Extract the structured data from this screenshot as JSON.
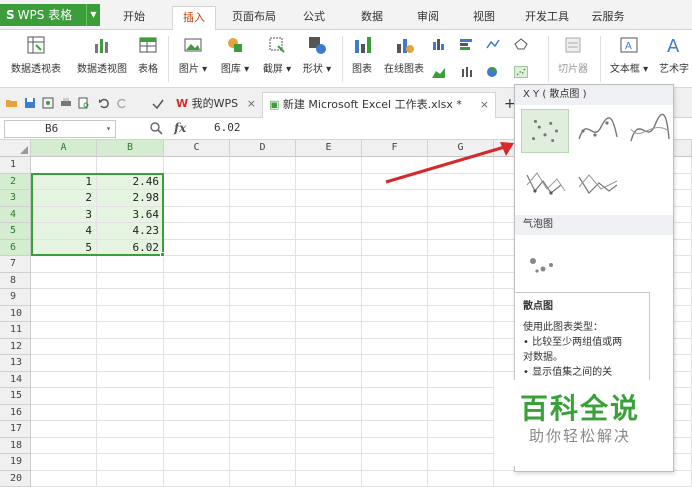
{
  "app": {
    "name": "WPS 表格",
    "logo": "S"
  },
  "ribbon_tabs": [
    {
      "label": "开始"
    },
    {
      "label": "插入"
    },
    {
      "label": "页面布局"
    },
    {
      "label": "公式"
    },
    {
      "label": "数据"
    },
    {
      "label": "审阅"
    },
    {
      "label": "视图"
    },
    {
      "label": "开发工具"
    },
    {
      "label": "云服务"
    }
  ],
  "active_tab": "插入",
  "toolbar": {
    "pivot_table": "数据透视表",
    "pivot_chart": "数据透视图",
    "table": "表格",
    "picture": "图片",
    "gallery": "图库",
    "screenshot": "截屏",
    "shape": "形状",
    "chart": "图表",
    "online_chart": "在线图表",
    "slicer": "切片器",
    "textbox": "文本框",
    "art": "艺术字"
  },
  "doc_tabs": {
    "mywps": "我的WPS",
    "workbook": "新建 Microsoft Excel 工作表.xlsx *",
    "close": "×",
    "add": "+"
  },
  "formula_bar": {
    "cell_ref": "B6",
    "fx": "fx",
    "value": "6.02"
  },
  "columns": [
    "A",
    "B",
    "C",
    "D",
    "E",
    "F",
    "G"
  ],
  "rows": [
    "1",
    "2",
    "3",
    "4",
    "5",
    "6",
    "7",
    "8",
    "9",
    "10",
    "11",
    "12",
    "13",
    "14",
    "15",
    "16",
    "17",
    "18",
    "19",
    "20"
  ],
  "cells": [
    {
      "a": "1",
      "b": "2.46"
    },
    {
      "a": "2",
      "b": "2.98"
    },
    {
      "a": "3",
      "b": "3.64"
    },
    {
      "a": "4",
      "b": "4.23"
    },
    {
      "a": "5",
      "b": "6.02"
    }
  ],
  "chart_panel": {
    "xy_header": "X Y ( 散点图 )",
    "bubble_header": "气泡图"
  },
  "tooltip": {
    "title": "散点图",
    "line1": "使用此图表类型：",
    "line2": "• 比较至少两组值或两",
    "line3": "对数据。",
    "line4": "• 显示值集之间的关"
  },
  "watermark": {
    "title": "百科全说",
    "subtitle": "助你轻松解决"
  },
  "colors": {
    "accent": "#3b9e3b",
    "arrow": "#d42a2a",
    "active_tab_text": "#c04000"
  }
}
